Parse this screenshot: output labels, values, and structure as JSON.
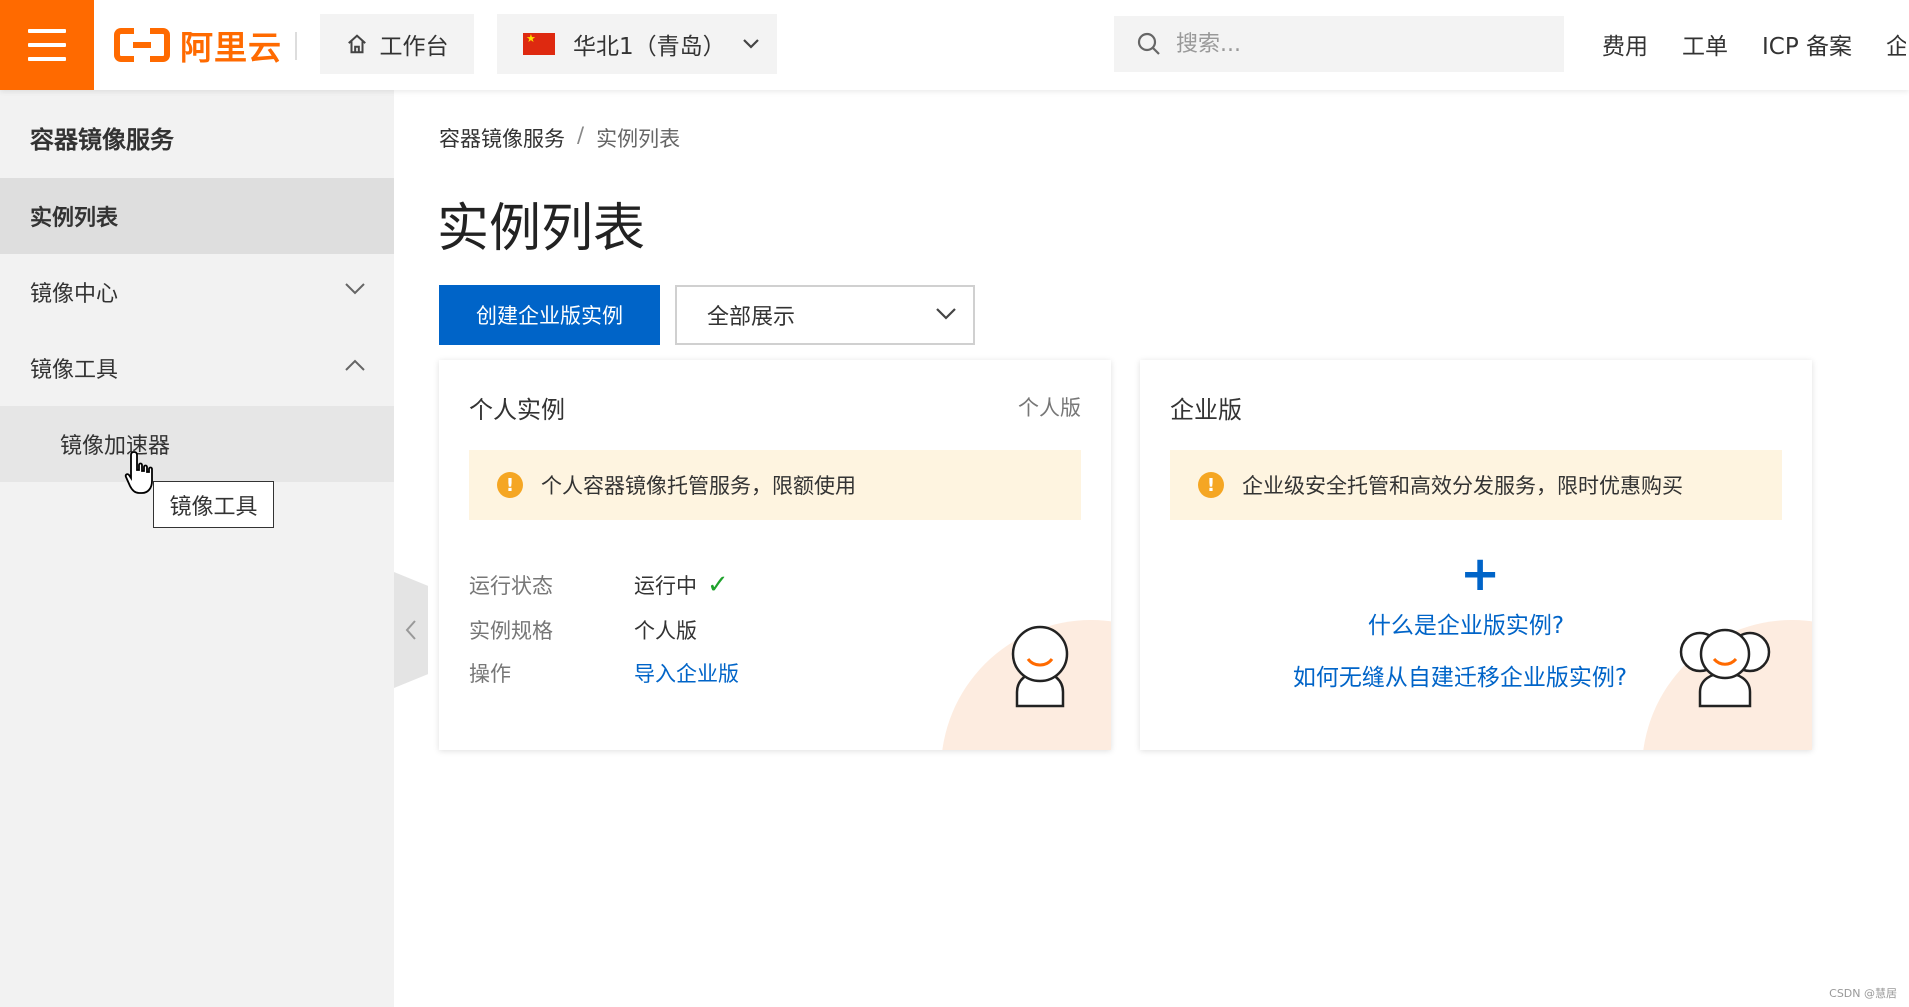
{
  "topbar": {
    "logo_text": "阿里云",
    "workbench_label": "工作台",
    "region_label": "华北1（青岛）",
    "search_placeholder": "搜索...",
    "links": [
      "费用",
      "工单",
      "ICP 备案",
      "企"
    ],
    "icons": {
      "menu": "hamburger-icon",
      "home": "home-icon",
      "flag": "china-flag-icon",
      "search": "search-icon",
      "chevron": "chevron-down-icon"
    },
    "brand_color": "#ff6a00"
  },
  "sidebar": {
    "title": "容器镜像服务",
    "items": [
      {
        "label": "实例列表",
        "active": true
      },
      {
        "label": "镜像中心",
        "expanded": false
      },
      {
        "label": "镜像工具",
        "expanded": true
      }
    ],
    "sub_items": [
      {
        "label": "镜像加速器"
      }
    ],
    "tooltip": "镜像工具"
  },
  "main": {
    "breadcrumb": {
      "root": "容器镜像服务",
      "separator": "/",
      "current": "实例列表"
    },
    "title": "实例列表",
    "create_button": "创建企业版实例",
    "filter_select": "全部展示",
    "accent_color": "#0064c8"
  },
  "personal_card": {
    "title": "个人实例",
    "tag": "个人版",
    "notice": "个人容器镜像托管服务，限额使用",
    "rows": [
      {
        "key": "运行状态",
        "value": "运行中"
      },
      {
        "key": "实例规格",
        "value": "个人版"
      },
      {
        "key": "操作",
        "value": "导入企业版"
      }
    ]
  },
  "enterprise_card": {
    "title": "企业版",
    "notice": "企业级安全托管和高效分发服务，限时优惠购买",
    "plus": "+",
    "link1": "什么是企业版实例?",
    "link2": "如何无缝从自建迁移企业版实例?"
  },
  "watermark": "CSDN @慧居"
}
